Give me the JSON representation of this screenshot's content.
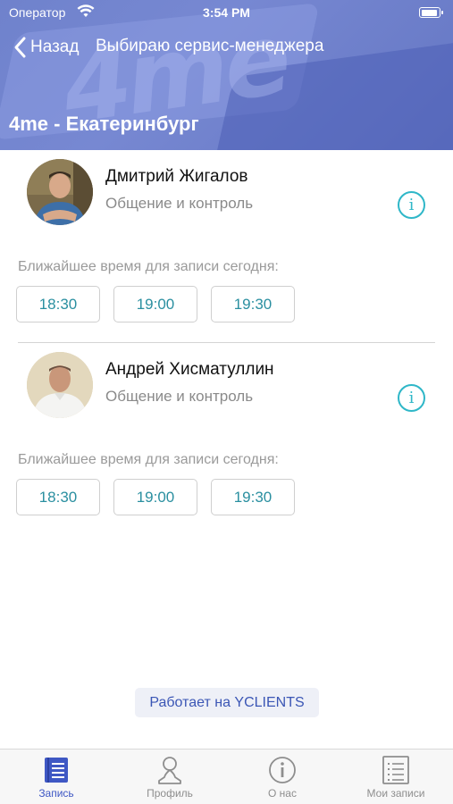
{
  "status_bar": {
    "carrier": "Оператор",
    "time": "3:54 PM"
  },
  "nav": {
    "back_label": "Назад",
    "title": "Выбираю сервис-менеджера"
  },
  "salon": {
    "name": "4me - Екатеринбург",
    "banner_text": "4me"
  },
  "slots_caption": "Ближайшее время для записи сегодня:",
  "staff": [
    {
      "name": "Дмитрий Жигалов",
      "role": "Общение и контроль",
      "slots": [
        "18:30",
        "19:00",
        "19:30"
      ]
    },
    {
      "name": "Андрей Хисматуллин",
      "role": "Общение и контроль",
      "slots": [
        "18:30",
        "19:00",
        "19:30"
      ]
    }
  ],
  "powered_by": "Работает на YCLIENTS",
  "tabbar": {
    "items": [
      {
        "label": "Запись",
        "icon": "book-icon",
        "active": true
      },
      {
        "label": "Профиль",
        "icon": "person-icon",
        "active": false
      },
      {
        "label": "О нас",
        "icon": "info-icon",
        "active": false
      },
      {
        "label": "Мои записи",
        "icon": "list-icon",
        "active": false
      }
    ]
  },
  "colors": {
    "accent": "#3f58c4",
    "slot_text": "#2a8fa0",
    "info_icon": "#2fb7c8",
    "header": "#6f82cc"
  }
}
